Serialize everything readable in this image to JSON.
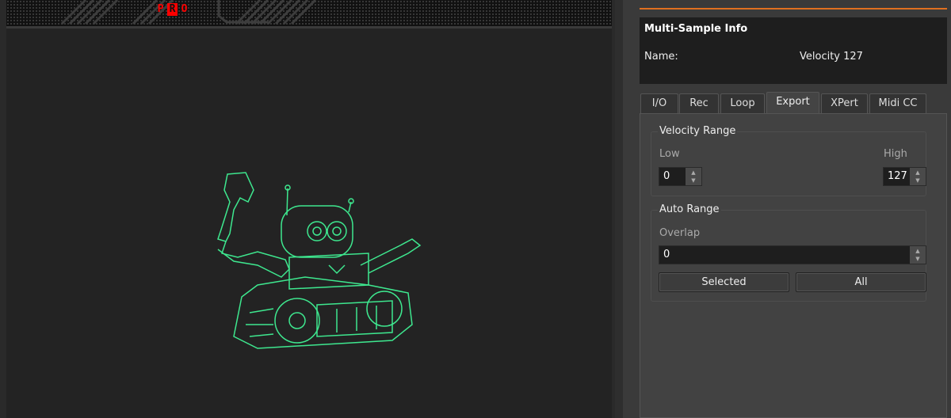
{
  "banner": {
    "logo_letters": [
      "P",
      "R",
      "O"
    ]
  },
  "info": {
    "title": "Multi-Sample Info",
    "name_label": "Name:",
    "name_value": "Velocity 127"
  },
  "tabs": [
    "I/O",
    "Rec",
    "Loop",
    "Export",
    "XPert",
    "Midi CC"
  ],
  "active_tab": "Export",
  "velocity_range": {
    "title": "Velocity Range",
    "low_label": "Low",
    "low_value": "0",
    "high_label": "High",
    "high_value": "127"
  },
  "auto_range": {
    "title": "Auto Range",
    "overlap_label": "Overlap",
    "overlap_value": "0",
    "selected_button": "Selected",
    "all_button": "All"
  },
  "colors": {
    "accent": "#e07020",
    "robot": "#3ee88f",
    "logo": "#ff0000"
  }
}
